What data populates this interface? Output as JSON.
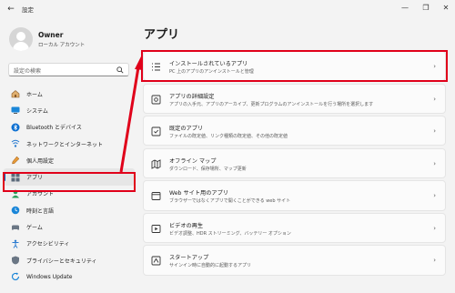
{
  "window": {
    "title": "設定",
    "back_glyph": "←",
    "min_glyph": "—",
    "max_glyph": "❐",
    "close_glyph": "✕"
  },
  "profile": {
    "name": "Owner",
    "account_type": "ローカル アカウント"
  },
  "search": {
    "placeholder": "設定の検索"
  },
  "sidebar": {
    "items": [
      {
        "label": "ホーム",
        "icon": "home-icon"
      },
      {
        "label": "システム",
        "icon": "system-icon"
      },
      {
        "label": "Bluetooth とデバイス",
        "icon": "bluetooth-icon"
      },
      {
        "label": "ネットワークとインターネット",
        "icon": "network-icon"
      },
      {
        "label": "個人用設定",
        "icon": "personalization-icon"
      },
      {
        "label": "アプリ",
        "icon": "apps-icon",
        "selected": true
      },
      {
        "label": "アカウント",
        "icon": "accounts-icon"
      },
      {
        "label": "時刻と言語",
        "icon": "time-language-icon"
      },
      {
        "label": "ゲーム",
        "icon": "gaming-icon"
      },
      {
        "label": "アクセシビリティ",
        "icon": "accessibility-icon"
      },
      {
        "label": "プライバシーとセキュリティ",
        "icon": "privacy-icon"
      },
      {
        "label": "Windows Update",
        "icon": "windows-update-icon"
      }
    ]
  },
  "main": {
    "title": "アプリ",
    "cards": [
      {
        "title": "インストールされているアプリ",
        "desc": "PC 上のアプリのアンインストールと管理",
        "icon": "installed-apps-icon",
        "highlighted": true
      },
      {
        "title": "アプリの詳細設定",
        "desc": "アプリの入手元、アプリのアーカイブ、更新プログラムのアンインストールを行う場所を選択します",
        "icon": "advanced-app-settings-icon"
      },
      {
        "title": "既定のアプリ",
        "desc": "ファイルの既定値、リンク種類の既定値、その他の既定値",
        "icon": "default-apps-icon"
      },
      {
        "title": "オフライン マップ",
        "desc": "ダウンロード、保存場所、マップ更新",
        "icon": "offline-maps-icon"
      },
      {
        "title": "Web サイト用のアプリ",
        "desc": "ブラウザーではなくアプリで開くことができる web サイト",
        "icon": "apps-for-websites-icon"
      },
      {
        "title": "ビデオの再生",
        "desc": "ビデオ調整、HDR ストリーミング、バッテリー オプション",
        "icon": "video-playback-icon"
      },
      {
        "title": "スタートアップ",
        "desc": "サインイン時に自動的に起動するアプリ",
        "icon": "startup-icon"
      }
    ],
    "chevron": "›"
  },
  "colors": {
    "accent": "#0067c0",
    "annotation": "#e0001a",
    "background": "#f3f3f3",
    "card": "#fbfbfb"
  }
}
